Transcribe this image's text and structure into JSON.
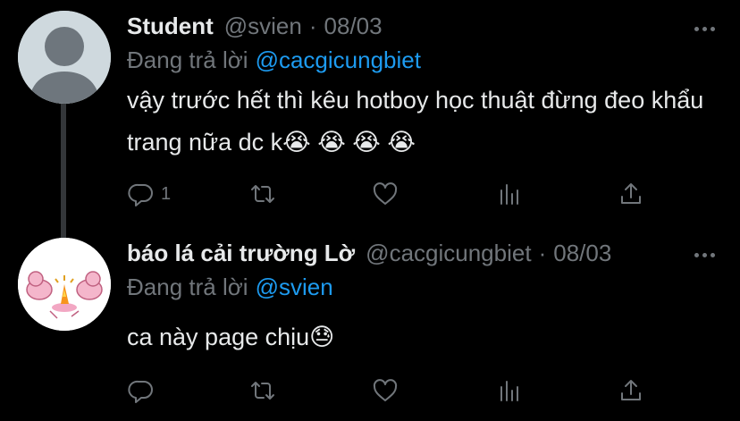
{
  "tweets": [
    {
      "author": {
        "name": "Student",
        "handle": "@svien",
        "avatar_icon": "default-avatar-icon"
      },
      "date": "08/03",
      "reply_prefix": "Đang trả lời",
      "reply_mention": "@cacgicungbiet",
      "text": "vậy trước hết thì kêu hotboy học thuật đừng đeo khẩu trang nữa dc k😭 😭 😭 😭",
      "reply_count": "1"
    },
    {
      "author": {
        "name": "báo lá cải trường Lờ",
        "handle": "@cacgicungbiet",
        "avatar_icon": "cartoon-avatar-icon"
      },
      "date": "08/03",
      "reply_prefix": "Đang trả lời",
      "reply_mention": "@svien",
      "text": "ca này page chịu😓",
      "reply_count": ""
    }
  ],
  "separator": "·",
  "colors": {
    "background": "#000000",
    "text": "#e7e9ea",
    "muted": "#71767b",
    "accent": "#1d9bf0",
    "thread_line": "#333639"
  },
  "action_icons": [
    "reply-icon",
    "retweet-icon",
    "like-icon",
    "analytics-icon",
    "share-icon"
  ]
}
